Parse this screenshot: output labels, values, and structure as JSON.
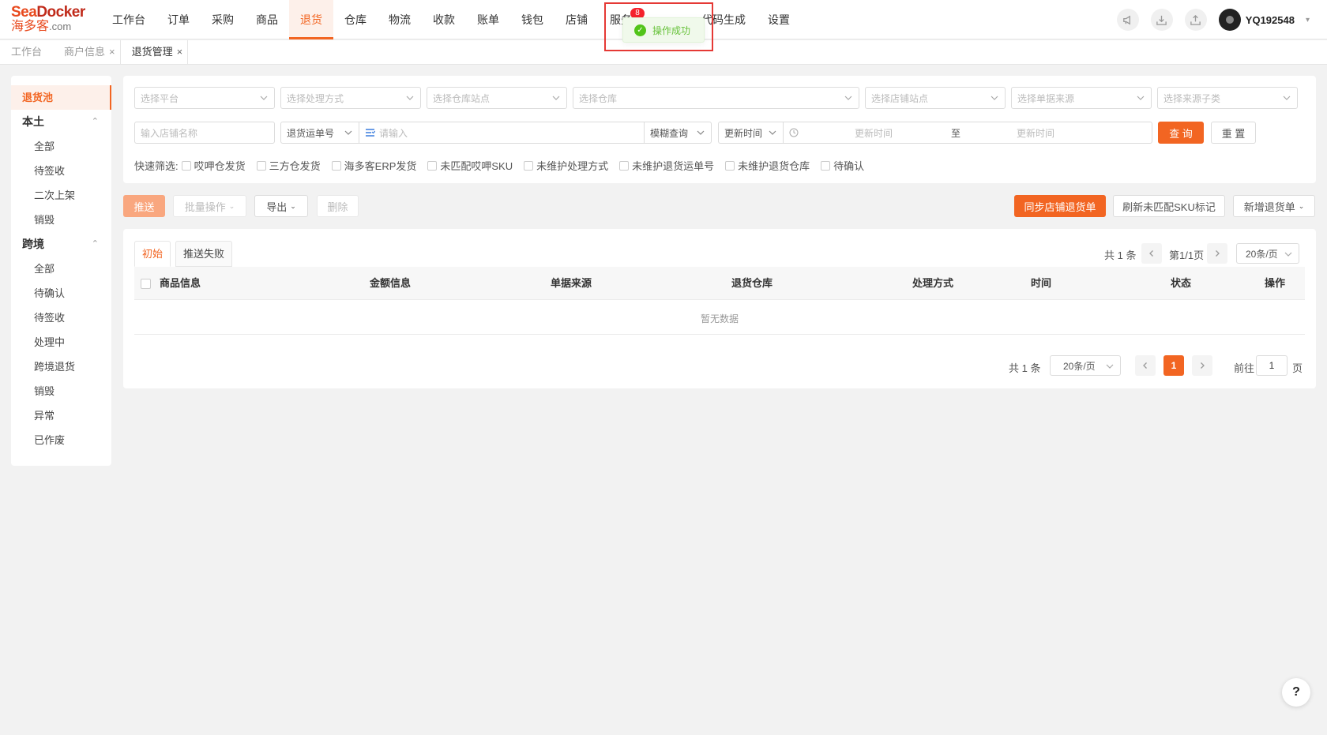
{
  "brand": {
    "top_a": "Sea",
    "top_b": "Docker",
    "bottom": "海多客",
    "com": ".com"
  },
  "nav": {
    "items": [
      "工作台",
      "订单",
      "采购",
      "商品",
      "退货",
      "仓库",
      "物流",
      "收款",
      "账单",
      "钱包",
      "店铺",
      "服务商"
    ],
    "tail_items": [
      "代码生成",
      "设置"
    ],
    "badge": "8",
    "active": "退货"
  },
  "user": {
    "name": "YQ192548"
  },
  "toast": {
    "message": "操作成功"
  },
  "page_tabs": [
    {
      "label": "工作台"
    },
    {
      "label": "商户信息"
    },
    {
      "label": "退货管理"
    }
  ],
  "sidebar": {
    "top": "退货池",
    "groups": [
      {
        "label": "本土",
        "items": [
          "全部",
          "待签收",
          "二次上架",
          "销毁"
        ]
      },
      {
        "label": "跨境",
        "items": [
          "全部",
          "待确认",
          "待签收",
          "处理中",
          "跨境退货",
          "销毁",
          "异常",
          "已作废"
        ]
      }
    ]
  },
  "filters": {
    "platform": "选择平台",
    "handle_method": "选择处理方式",
    "warehouse_site": "选择仓库站点",
    "warehouse": "选择仓库",
    "store_site": "选择店铺站点",
    "doc_source": "选择单据来源",
    "source_subtype": "选择来源子类",
    "store_name": "输入店铺名称",
    "waybill_type": "退货运单号",
    "keyword_placeholder": "请输入",
    "match_mode": "模糊查询",
    "time_type": "更新时间",
    "time_start": "更新时间",
    "time_sep": "至",
    "time_end": "更新时间",
    "query": "查 询",
    "reset": "重 置"
  },
  "quick_filters": {
    "label": "快速筛选:",
    "items": [
      "哎呷仓发货",
      "三方仓发货",
      "海多客ERP发货",
      "未匹配哎呷SKU",
      "未维护处理方式",
      "未维护退货运单号",
      "未维护退货仓库",
      "待确认"
    ]
  },
  "toolbar": {
    "push": "推送",
    "batch": "批量操作",
    "export": "导出",
    "delete": "删除",
    "sync": "同步店铺退货单",
    "refresh": "刷新未匹配SKU标记",
    "add": "新增退货单"
  },
  "table": {
    "tabs": [
      "初始",
      "推送失败"
    ],
    "columns": [
      "商品信息",
      "金额信息",
      "单据来源",
      "退货仓库",
      "处理方式",
      "时间",
      "状态",
      "操作"
    ],
    "empty": "暂无数据"
  },
  "pager_top": {
    "total": "共 1 条",
    "page": "第1/1页",
    "size": "20条/页"
  },
  "pager_bottom": {
    "total": "共 1 条",
    "size": "20条/页",
    "current": "1",
    "goto_label": "前往",
    "goto_value": "1",
    "page_unit": "页"
  },
  "help": "?",
  "colors": {
    "accent": "#f26522",
    "success": "#52c41a",
    "highlight_frame": "#e53935"
  }
}
